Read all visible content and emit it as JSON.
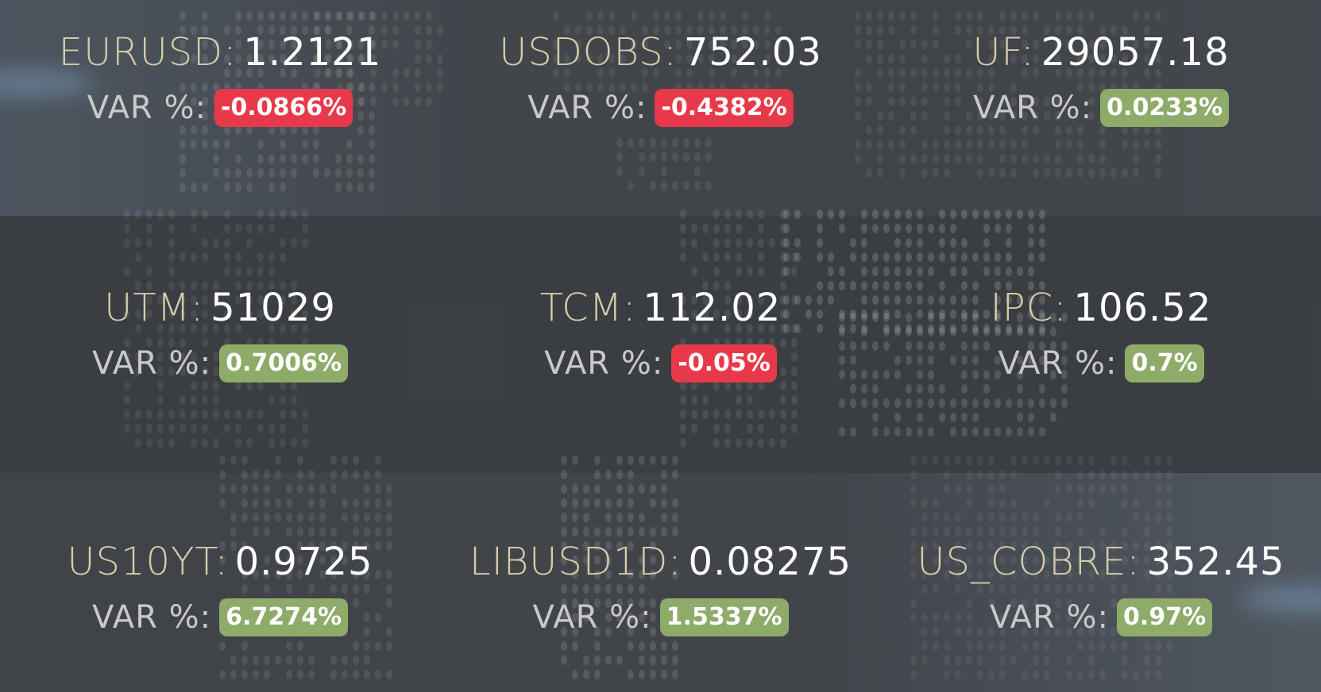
{
  "var_label": "VAR %:",
  "colors": {
    "negative": "#e8394a",
    "positive": "#8fab6a",
    "symbol": "#d6ccaa",
    "value": "#ffffff"
  },
  "tickers": [
    {
      "symbol": "EURUSD:",
      "value": "1.2121",
      "change": "-0.0866%",
      "direction": "negative"
    },
    {
      "symbol": "USDOBS:",
      "value": "752.03",
      "change": "-0.4382%",
      "direction": "negative"
    },
    {
      "symbol": "UF:",
      "value": "29057.18",
      "change": "0.0233%",
      "direction": "positive"
    },
    {
      "symbol": "UTM:",
      "value": "51029",
      "change": "0.7006%",
      "direction": "positive"
    },
    {
      "symbol": "TCM:",
      "value": "112.02",
      "change": "-0.05%",
      "direction": "negative"
    },
    {
      "symbol": "IPC:",
      "value": "106.52",
      "change": "0.7%",
      "direction": "positive"
    },
    {
      "symbol": "US10YT:",
      "value": "0.9725",
      "change": "6.7274%",
      "direction": "positive"
    },
    {
      "symbol": "LIBUSD1D:",
      "value": "0.08275",
      "change": "1.5337%",
      "direction": "positive"
    },
    {
      "symbol": "US_COBRE:",
      "value": "352.45",
      "change": "0.97%",
      "direction": "positive"
    }
  ]
}
